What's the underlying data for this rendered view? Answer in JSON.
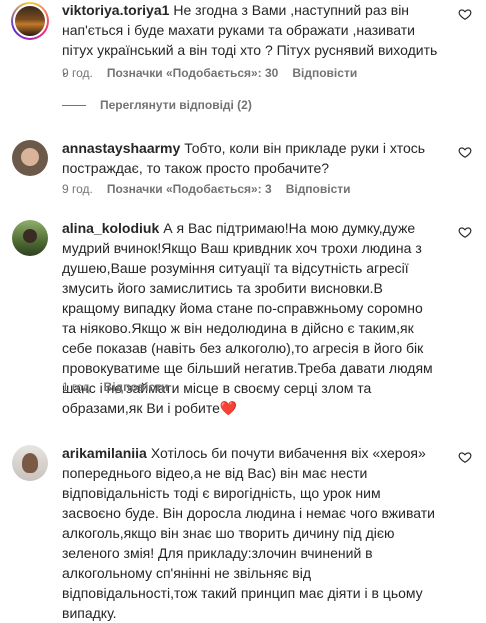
{
  "comments": [
    {
      "username": "viktoriya.toriya1",
      "text": "Не згодна з Вами ,наступний раз він нап'ється і буде махати руками та ображати ,називати пітух український а він тоді хто ? Пітух руснявий виходить .",
      "time": "9 год.",
      "likes": "Позначки «Подобається»: 30",
      "reply": "Відповісти",
      "view_replies": "Переглянути відповіді (2)"
    },
    {
      "username": "annastayshaarmy",
      "text": "Тобто, коли він прикладе руки і хтось постраждає, то також просто пробачите?",
      "time": "9 год.",
      "likes": "Позначки «Подобається»: 3",
      "reply": "Відповісти"
    },
    {
      "username": "alina_kolodiuk",
      "text": "А я Вас підтримаю!На мою думку,дуже мудрий вчинок!Якщо Ваш кривдник хоч трохи людина з душею,Ваше розуміння ситуації та відсутність агресії змусить його замислитись та зробити висновки.В кращому випадку йома стане по-справжньому соромно та ніяково.Якщо ж він недолюдина в дійсно є таким,як себе показав (навіть без алкоголю),то агресія в його бік провокуватиме ще більший негатив.Треба давати людям шанс і не займати місце в своєму серці злом та образами,як Ви і робите",
      "emoji": "❤️",
      "time": "1 год",
      "reply": "Відповісти"
    },
    {
      "username": "arikamilaniia",
      "text": "Хотілось би почути вибачення віх «хероя» попереднього відео,а не від Вас) він має нести відповідальність тоді є вирогідність, що урок ним засвоєно буде. Він доросла людина і немає чого вживати алкоголь,якщо він знає шо творить дичину під дією зеленого змія! Для прикладу:злочин вчинений в алкогольному сп'янінні не звільняє від відповідальності,тож такий принцип має діяти і в цьому випадку."
    }
  ],
  "icons": {
    "like": "heart-outline-icon"
  }
}
